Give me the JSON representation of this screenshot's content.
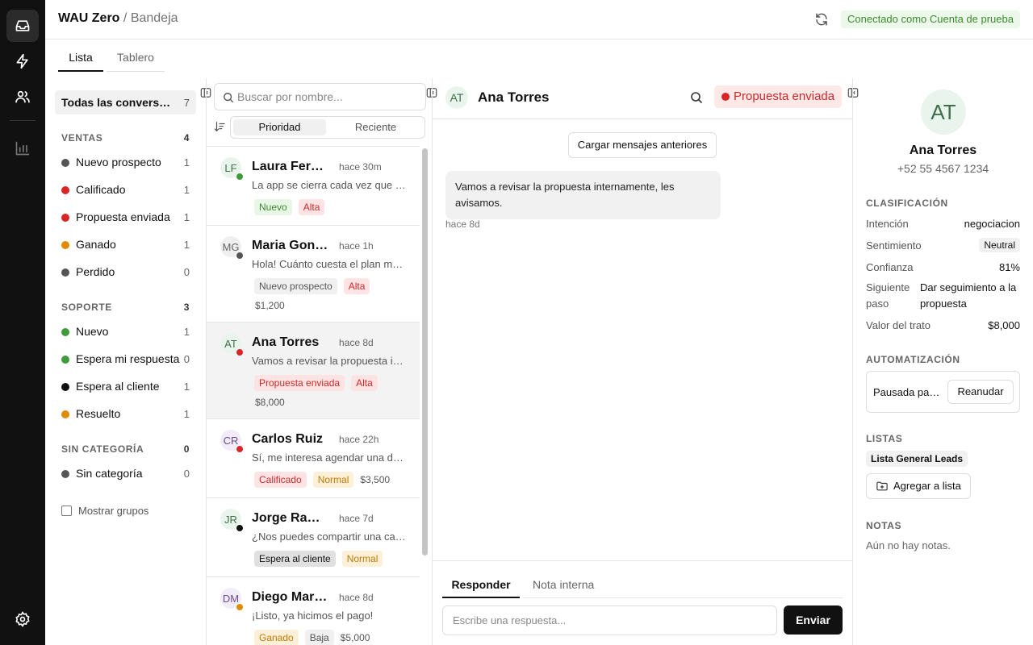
{
  "app": {
    "name": "WAU Zero",
    "separator": "/",
    "section": "Bandeja"
  },
  "connection": {
    "label": "Conectado como Cuenta de prueba"
  },
  "view_tabs": [
    "Lista",
    "Tablero"
  ],
  "filters": {
    "all": {
      "label": "Todas las conversaciones",
      "count": "7"
    },
    "groups": [
      {
        "title": "VENTAS",
        "count": "4",
        "items": [
          {
            "label": "Nuevo prospecto",
            "count": "1",
            "color": "#555555"
          },
          {
            "label": "Calificado",
            "count": "1",
            "color": "#d92525"
          },
          {
            "label": "Propuesta enviada",
            "count": "1",
            "color": "#d92525"
          },
          {
            "label": "Ganado",
            "count": "1",
            "color": "#e08a00"
          },
          {
            "label": "Perdido",
            "count": "0",
            "color": "#555555"
          }
        ]
      },
      {
        "title": "SOPORTE",
        "count": "3",
        "items": [
          {
            "label": "Nuevo",
            "count": "1",
            "color": "#3e9b3a"
          },
          {
            "label": "Espera mi respuesta",
            "count": "0",
            "color": "#3e9b3a"
          },
          {
            "label": "Espera al cliente",
            "count": "1",
            "color": "#111111"
          },
          {
            "label": "Resuelto",
            "count": "1",
            "color": "#e08a00"
          }
        ]
      },
      {
        "title": "SIN CATEGORÍA",
        "count": "0",
        "items": [
          {
            "label": "Sin categoría",
            "count": "0",
            "color": "#555555"
          }
        ]
      }
    ],
    "show_groups": "Mostrar grupos"
  },
  "search": {
    "placeholder": "Buscar por nombre..."
  },
  "sort": {
    "options": [
      "Prioridad",
      "Reciente"
    ],
    "selected": "Prioridad"
  },
  "conversations": [
    {
      "initials": "LF",
      "name": "Laura Fernández",
      "time": "hace 30m",
      "preview": "La app se cierra cada vez que intento abrirla",
      "tags": [
        {
          "label": "Nuevo",
          "kind": "green"
        },
        {
          "label": "Alta",
          "kind": "red"
        }
      ],
      "amount": "",
      "dot": "#3e9b3a",
      "avatar_bg": "#e9f5ec",
      "avatar_fg": "#3f6f4a"
    },
    {
      "initials": "MG",
      "name": "Maria Gonzalez",
      "time": "hace 1h",
      "preview": "Hola! Cuánto cuesta el plan mensual?",
      "tags": [
        {
          "label": "Nuevo prospecto",
          "kind": "gray"
        },
        {
          "label": "Alta",
          "kind": "red"
        }
      ],
      "amount": "$1,200",
      "dot": "#555555",
      "avatar_bg": "#efefef",
      "avatar_fg": "#666666"
    },
    {
      "initials": "AT",
      "name": "Ana Torres",
      "time": "hace 8d",
      "preview": "Vamos a revisar la propuesta internamente",
      "tags": [
        {
          "label": "Propuesta enviada",
          "kind": "red"
        },
        {
          "label": "Alta",
          "kind": "red"
        }
      ],
      "amount": "$8,000",
      "dot": "#d92525",
      "avatar_bg": "#e9f5ec",
      "avatar_fg": "#3f6f4a"
    },
    {
      "initials": "CR",
      "name": "Carlos Ruiz",
      "time": "hace 22h",
      "preview": "Sí, me interesa agendar una demo",
      "tags": [
        {
          "label": "Calificado",
          "kind": "red"
        },
        {
          "label": "Normal",
          "kind": "orange"
        }
      ],
      "amount": "$3,500",
      "dot": "#d92525",
      "avatar_bg": "#f1ecf8",
      "avatar_fg": "#6b4f8a"
    },
    {
      "initials": "JR",
      "name": "Jorge Ramirez",
      "time": "hace 7d",
      "preview": "¿Nos puedes compartir una captura?",
      "tags": [
        {
          "label": "Espera al cliente",
          "kind": "dark"
        },
        {
          "label": "Normal",
          "kind": "orange"
        }
      ],
      "amount": "",
      "dot": "#111111",
      "avatar_bg": "#e9f5ec",
      "avatar_fg": "#3f6f4a"
    },
    {
      "initials": "DM",
      "name": "Diego Martínez",
      "time": "hace 8d",
      "preview": "¡Listo, ya hicimos el pago!",
      "tags": [
        {
          "label": "Ganado",
          "kind": "orange"
        },
        {
          "label": "Baja",
          "kind": "gray"
        }
      ],
      "amount": "$5,000",
      "dot": "#e08a00",
      "avatar_bg": "#f1ecf8",
      "avatar_fg": "#6b4f8a"
    }
  ],
  "chat": {
    "initials": "AT",
    "name": "Ana Torres",
    "status": "Propuesta enviada",
    "load_more": "Cargar mensajes anteriores",
    "message": "Vamos a revisar la propuesta internamente, les avisamos.",
    "message_time": "hace 8d",
    "tabs": [
      "Responder",
      "Nota interna"
    ],
    "reply_placeholder": "Escribe una respuesta...",
    "send": "Enviar"
  },
  "details": {
    "initials": "AT",
    "name": "Ana Torres",
    "phone": "+52 55 4567 1234",
    "classification_title": "CLASIFICACIÓN",
    "intent": {
      "label": "Intención",
      "value": "negociacion"
    },
    "sentiment": {
      "label": "Sentimiento",
      "value": "Neutral"
    },
    "confidence": {
      "label": "Confianza",
      "value": "81%"
    },
    "next_step": {
      "label": "Siguiente paso",
      "value": "Dar seguimiento a la propuesta"
    },
    "deal_value": {
      "label": "Valor del trato",
      "value": "$8,000"
    },
    "automation_title": "AUTOMATIZACIÓN",
    "automation_status": "Pausada para esta conversación",
    "resume": "Reanudar",
    "lists_title": "LISTAS",
    "list_chip": "Lista General Leads",
    "add_list": "Agregar a lista",
    "notes_title": "NOTAS",
    "notes_empty": "Aún no hay notas."
  },
  "colors": {
    "tag_green_bg": "#e8f6e6",
    "tag_green_fg": "#3b8a2e",
    "tag_red_bg": "#fde3e3",
    "tag_red_fg": "#c92a2a",
    "tag_orange_bg": "#fdf0d8",
    "tag_orange_fg": "#c07a00",
    "tag_gray_bg": "#f0f0f0",
    "tag_gray_fg": "#555555",
    "tag_dark_bg": "#e0e0e0",
    "tag_dark_fg": "#111111"
  }
}
